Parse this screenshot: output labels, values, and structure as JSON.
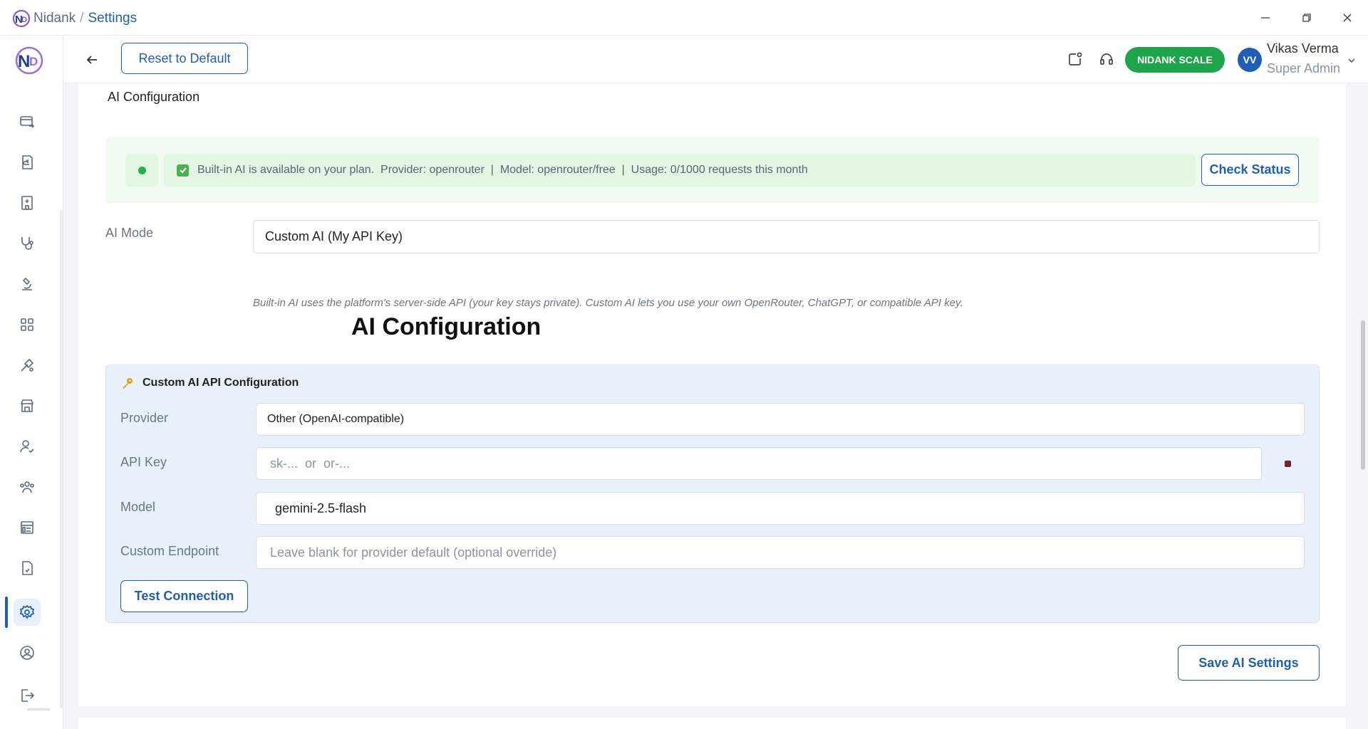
{
  "window": {
    "app_name": "Nidank",
    "separator": "/",
    "page_name": "Settings",
    "controls": [
      "minimize-icon",
      "restore-icon",
      "close-icon"
    ]
  },
  "sidebar": {
    "items": [
      {
        "icon": "billing-icon"
      },
      {
        "icon": "returns-icon"
      },
      {
        "icon": "building-icon"
      },
      {
        "icon": "stethoscope-icon"
      },
      {
        "icon": "microscope-icon"
      },
      {
        "icon": "grid-icon"
      },
      {
        "icon": "tools-icon"
      },
      {
        "icon": "store-icon"
      },
      {
        "icon": "user-check-icon"
      },
      {
        "icon": "users-icon"
      },
      {
        "icon": "list-icon"
      },
      {
        "icon": "document-icon"
      },
      {
        "icon": "settings-icon",
        "active": true
      },
      {
        "icon": "profile-icon"
      },
      {
        "icon": "logout-icon"
      }
    ]
  },
  "header": {
    "reset_label": "Reset to Default",
    "plan_badge": "NIDANK SCALE",
    "user": {
      "initials": "VV",
      "name": "Vikas Verma",
      "role": "Super Admin"
    }
  },
  "ai": {
    "section_title": "AI Configuration",
    "status_text": "Built-in AI is available on your plan.  Provider: openrouter  |  Model: openrouter/free  |  Usage: 0/1000 requests this month",
    "check_status_label": "Check Status",
    "mode_label": "AI Mode",
    "mode_value": "Custom AI (My API Key)",
    "help_text": "Built-in AI uses the platform's server-side API (your key stays private). Custom AI lets you use your own OpenRouter, ChatGPT, or compatible API key.",
    "big_title": "AI Configuration",
    "custom": {
      "title": "Custom AI API Configuration",
      "provider_label": "Provider",
      "provider_value": "Other (OpenAI-compatible)",
      "api_key_label": "API Key",
      "api_key_placeholder": "sk-...  or  or-...",
      "model_label": "Model",
      "model_value": " gemini-2.5-flash",
      "endpoint_label": "Custom Endpoint",
      "endpoint_placeholder": "Leave blank for provider default (optional override)",
      "test_label": "Test Connection"
    },
    "save_label": "Save AI Settings"
  },
  "colors": {
    "accent": "#1f5fb3",
    "badge_green": "#1ea44b",
    "status_bg": "#f1faf1",
    "panel_bg": "#e8f0fa"
  }
}
